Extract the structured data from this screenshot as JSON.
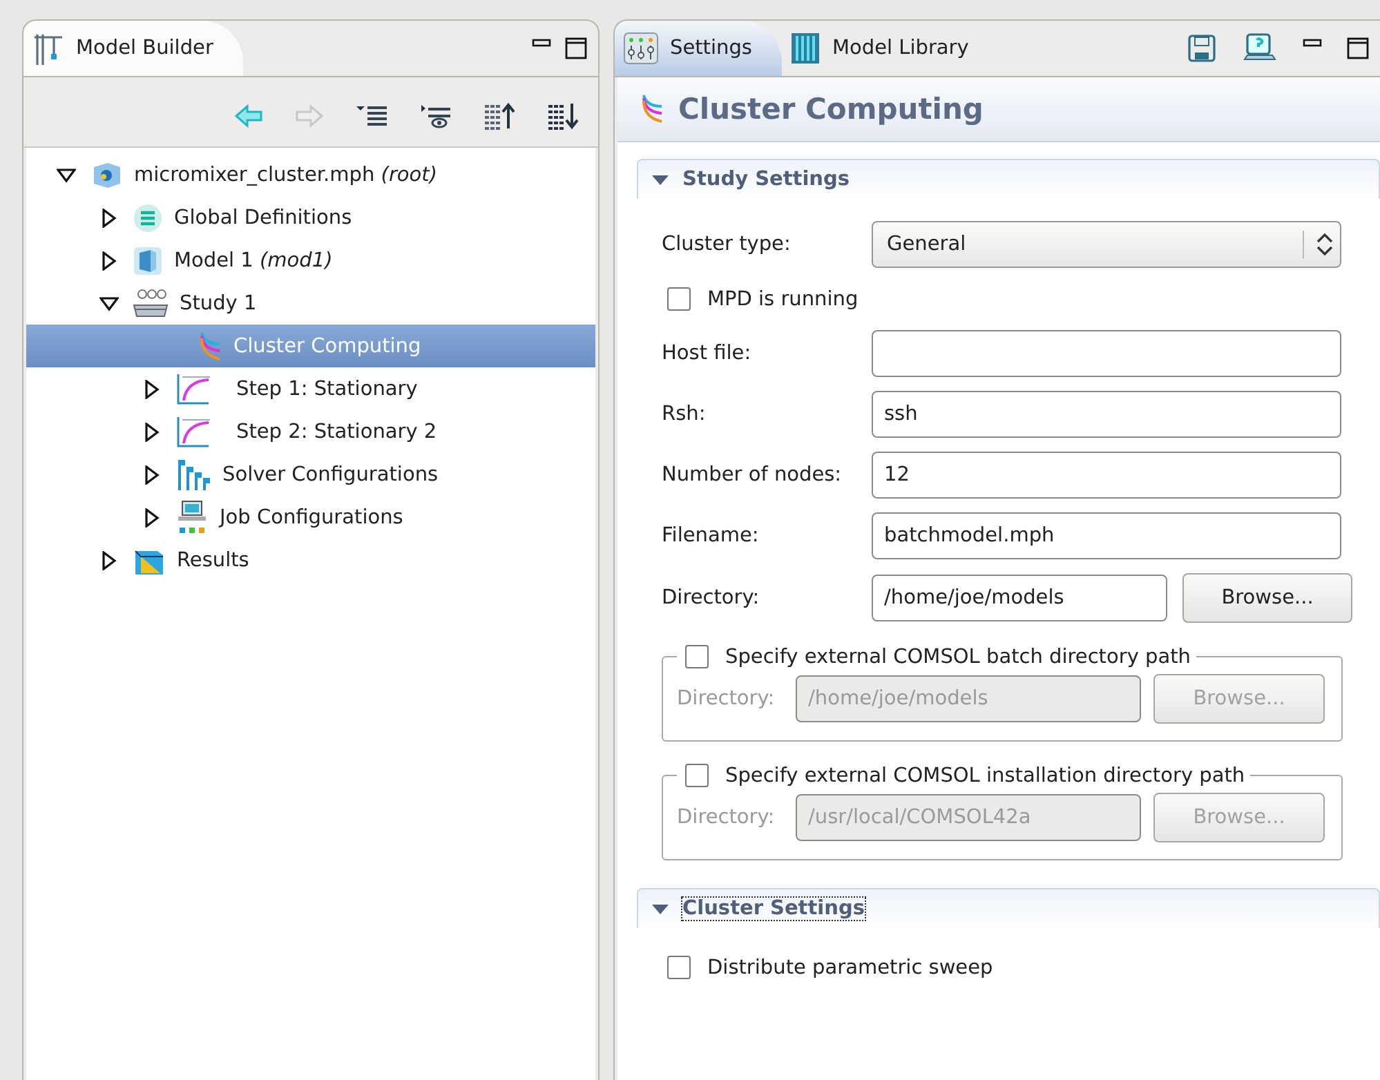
{
  "model_builder": {
    "tab": {
      "label": "Model Builder"
    },
    "tree": [
      {
        "label": "micromixer_cluster.mph *(root)*",
        "kind": "file",
        "expanded": true,
        "selected": false,
        "children": [
          {
            "label": "Global Definitions",
            "kind": "definitions",
            "expanded": false,
            "selected": false
          },
          {
            "label": "Model 1 *(mod1)*",
            "kind": "model",
            "expanded": false,
            "selected": false
          },
          {
            "label": "Study 1",
            "kind": "study",
            "expanded": true,
            "selected": false,
            "children": [
              {
                "label": "Cluster Computing",
                "kind": "cluster",
                "selected": true
              },
              {
                "label": "Step 1: Stationary",
                "kind": "step",
                "expanded": false,
                "selected": false
              },
              {
                "label": "Step 2: Stationary 2",
                "kind": "step",
                "expanded": false,
                "selected": false
              },
              {
                "label": "Solver Configurations",
                "kind": "solver",
                "expanded": false,
                "selected": false
              },
              {
                "label": "Job Configurations",
                "kind": "job",
                "expanded": false,
                "selected": false
              }
            ]
          },
          {
            "label": "Results",
            "kind": "results",
            "expanded": false,
            "selected": false
          }
        ]
      }
    ]
  },
  "settings": {
    "tabs": [
      {
        "label": "Settings",
        "kind": "settings",
        "selected": true
      },
      {
        "label": "Model Library",
        "kind": "library",
        "selected": false
      }
    ],
    "title": "Cluster Computing",
    "sections": [
      {
        "title": "Study Settings",
        "expanded": true,
        "focused": false,
        "fields": [
          {
            "kind": "select",
            "label": "Cluster type:",
            "value": "General"
          },
          {
            "kind": "checkbox",
            "label": "MPD is running",
            "checked": false
          },
          {
            "kind": "text",
            "label": "Host file:"
          },
          {
            "kind": "text",
            "label": "Rsh:",
            "value": "ssh"
          },
          {
            "kind": "text",
            "label": "Number of nodes:",
            "value": "12"
          },
          {
            "kind": "text",
            "label": "Filename:",
            "value": "batchmodel.mph"
          },
          {
            "kind": "browse",
            "label": "Directory:",
            "value": "/home/joe/models",
            "button": "Browse...",
            "disabled": false
          },
          {
            "kind": "group",
            "label": "Specify external COMSOL batch directory path",
            "checked": false,
            "field_label": "Directory:",
            "value": "/home/joe/models",
            "button": "Browse...",
            "disabled": true
          },
          {
            "kind": "group",
            "label": "Specify external COMSOL installation directory path",
            "checked": false,
            "field_label": "Directory:",
            "value": "/usr/local/COMSOL42a",
            "button": "Browse...",
            "disabled": true
          }
        ]
      },
      {
        "title": "Cluster Settings",
        "expanded": true,
        "focused": true,
        "fields": [
          {
            "kind": "checkbox",
            "label": "Distribute parametric sweep",
            "checked": false
          }
        ]
      }
    ]
  }
}
